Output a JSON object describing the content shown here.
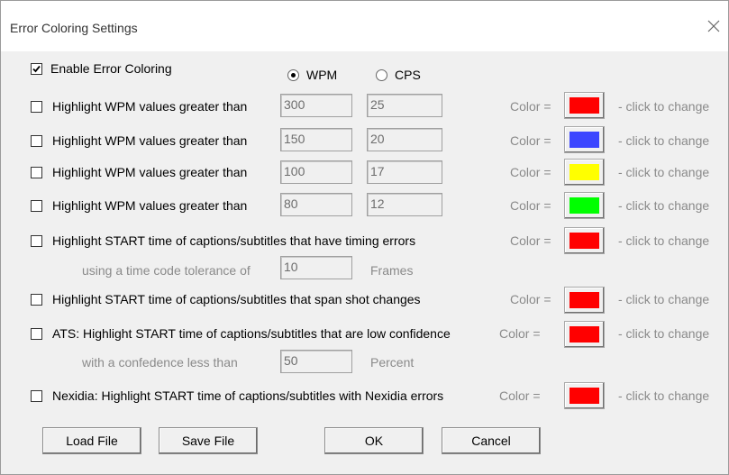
{
  "window": {
    "title": "Error Coloring Settings"
  },
  "enable": {
    "label": "Enable Error Coloring",
    "checked": true
  },
  "mode": {
    "wpm_label": "WPM",
    "cps_label": "CPS",
    "selected": "WPM"
  },
  "rows": [
    {
      "label": "Highlight WPM values greater than",
      "value1": "300",
      "value2": "25",
      "color_label": "Color =",
      "change_label": "- click to change",
      "color": "#ff0000",
      "checked": false
    },
    {
      "label": "Highlight WPM values greater than",
      "value1": "150",
      "value2": "20",
      "color_label": "Color =",
      "change_label": "- click to change",
      "color": "#3c46ff",
      "checked": false
    },
    {
      "label": "Highlight WPM values greater than",
      "value1": "100",
      "value2": "17",
      "color_label": "Color =",
      "change_label": "- click to change",
      "color": "#ffff00",
      "checked": false
    },
    {
      "label": "Highlight WPM values greater than",
      "value1": "80",
      "value2": "12",
      "color_label": "Color =",
      "change_label": "- click to change",
      "color": "#00ff00",
      "checked": false
    }
  ],
  "timing": {
    "label": "Highlight START time of captions/subtitles that have timing errors",
    "color_label": "Color =",
    "change_label": "- click to change",
    "color": "#ff0000",
    "checked": false,
    "tolerance_prefix": "using a time code tolerance of",
    "tolerance_value": "10",
    "tolerance_unit": "Frames"
  },
  "shot": {
    "label": "Highlight START time of captions/subtitles that span shot changes",
    "color_label": "Color =",
    "change_label": "- click to change",
    "color": "#ff0000",
    "checked": false
  },
  "ats": {
    "label": "ATS: Highlight START time of captions/subtitles that are low confidence",
    "color_label": "Color =",
    "change_label": "- click to change",
    "color": "#ff0000",
    "checked": false,
    "confidence_prefix": "with a confedence less than",
    "confidence_value": "50",
    "confidence_unit": "Percent"
  },
  "nexidia": {
    "label": "Nexidia: Highlight START time of captions/subtitles with Nexidia errors",
    "color_label": "Color =",
    "change_label": "- click to change",
    "color": "#ff0000",
    "checked": false
  },
  "buttons": {
    "load": "Load File",
    "save": "Save File",
    "ok": "OK",
    "cancel": "Cancel"
  },
  "icons": {
    "close": "close-icon",
    "check": "check-icon"
  }
}
